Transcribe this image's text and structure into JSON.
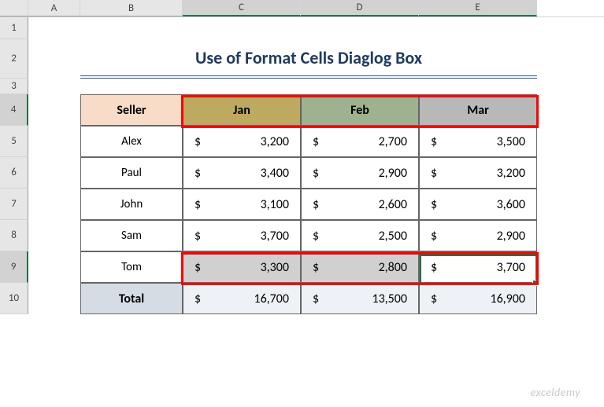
{
  "columns": {
    "A": "A",
    "B": "B",
    "C": "C",
    "D": "D",
    "E": "E"
  },
  "rows": {
    "1": "1",
    "2": "2",
    "3": "3",
    "4": "4",
    "5": "5",
    "6": "6",
    "7": "7",
    "8": "8",
    "9": "9",
    "10": "10"
  },
  "title": "Use of Format Cells Diaglog Box",
  "headers": {
    "seller": "Seller",
    "jan": "Jan",
    "feb": "Feb",
    "mar": "Mar"
  },
  "currency": "$",
  "data": [
    {
      "name": "Alex",
      "jan": "3,200",
      "feb": "2,700",
      "mar": "3,500"
    },
    {
      "name": "Paul",
      "jan": "3,400",
      "feb": "2,900",
      "mar": "3,200"
    },
    {
      "name": "John",
      "jan": "3,100",
      "feb": "2,600",
      "mar": "3,600"
    },
    {
      "name": "Sam",
      "jan": "3,700",
      "feb": "2,500",
      "mar": "2,900"
    },
    {
      "name": "Tom",
      "jan": "3,300",
      "feb": "2,800",
      "mar": "3,700"
    }
  ],
  "total": {
    "label": "Total",
    "jan": "16,700",
    "feb": "13,500",
    "mar": "16,900"
  },
  "watermark": "exceldemy"
}
